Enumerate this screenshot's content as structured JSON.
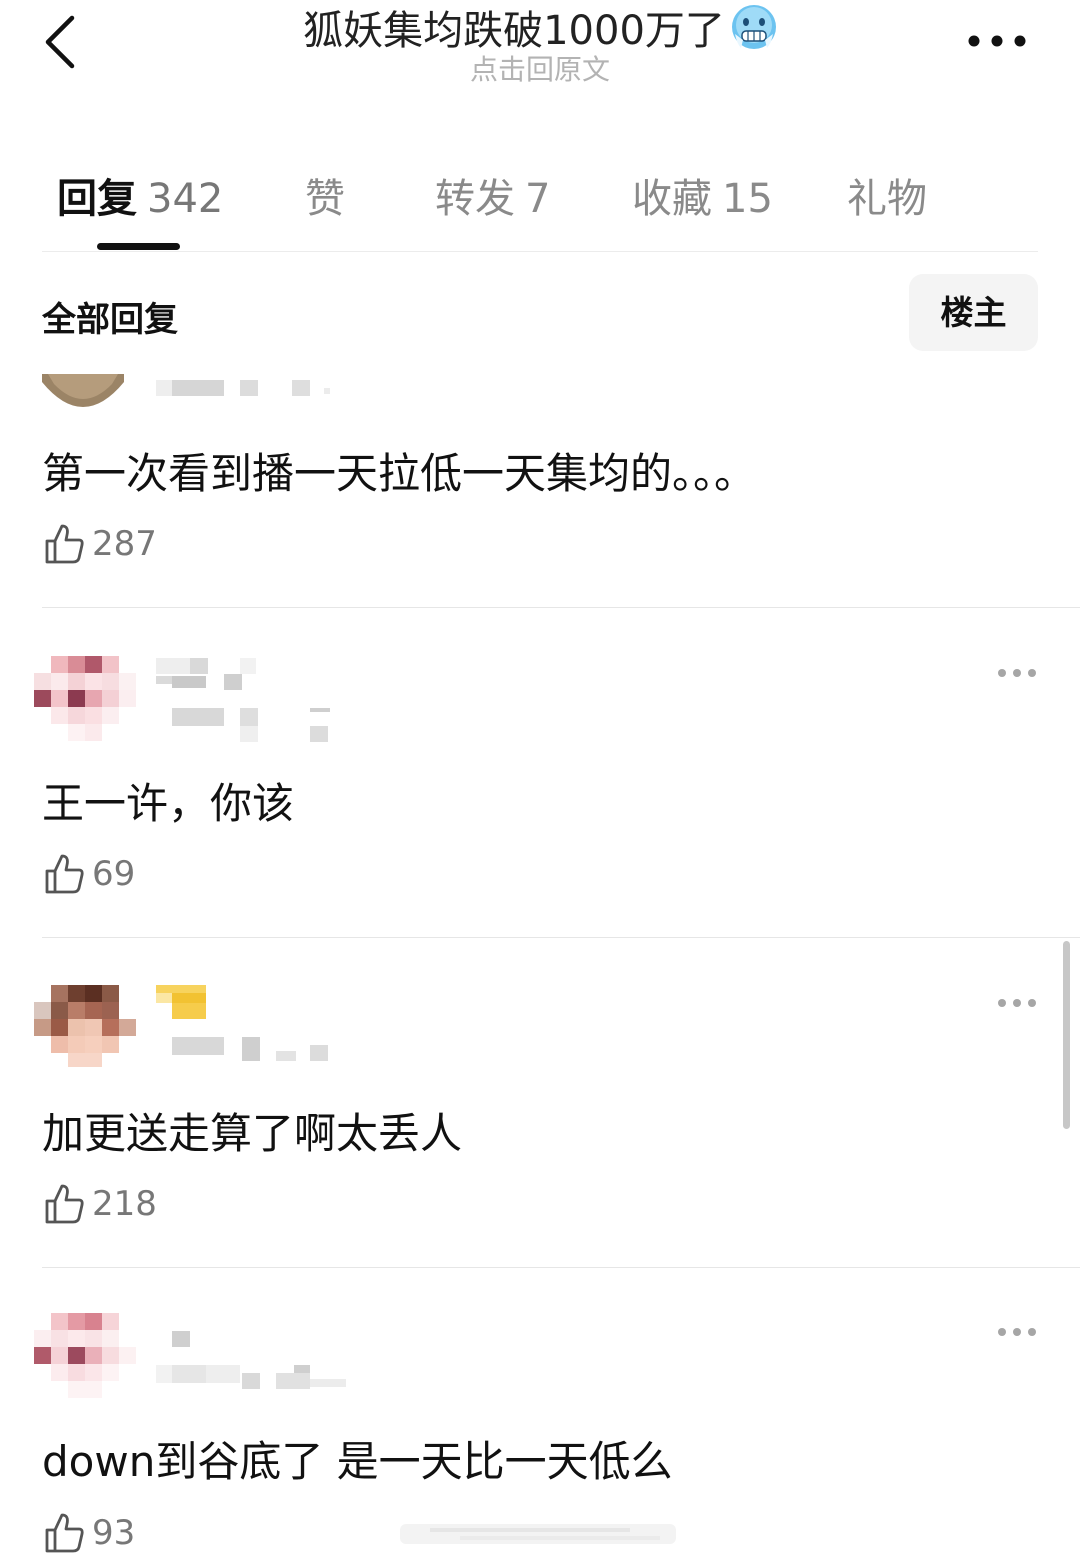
{
  "header": {
    "title": "狐妖集均跌破1000万了",
    "title_emoji": "cold-face-emoji",
    "subtitle": "点击回原文"
  },
  "tabs": [
    {
      "label": "回复",
      "count": "342",
      "active": true
    },
    {
      "label": "赞",
      "count": "",
      "active": false
    },
    {
      "label": "转发",
      "count": "7",
      "active": false
    },
    {
      "label": "收藏",
      "count": "15",
      "active": false
    },
    {
      "label": "礼物",
      "count": "",
      "active": false
    }
  ],
  "section": {
    "title": "全部回复",
    "owner_button": "楼主"
  },
  "comments": [
    {
      "text": "第一次看到播一天拉低一天集均的。。。",
      "likes": "287"
    },
    {
      "text": "王一许，你该",
      "likes": "69"
    },
    {
      "text": "加更送走算了啊太丢人",
      "likes": "218"
    },
    {
      "text": "down到谷底了 是一天比一天低么",
      "likes": "93"
    }
  ],
  "icons": {
    "back": "chevron-left-icon",
    "more": "more-dots-icon",
    "like": "thumbs-up-icon"
  },
  "colors": {
    "accent": "#111111",
    "muted": "#8a8a8a",
    "divider": "#e6e6e6",
    "owner_button_bg": "#f4f4f4"
  }
}
